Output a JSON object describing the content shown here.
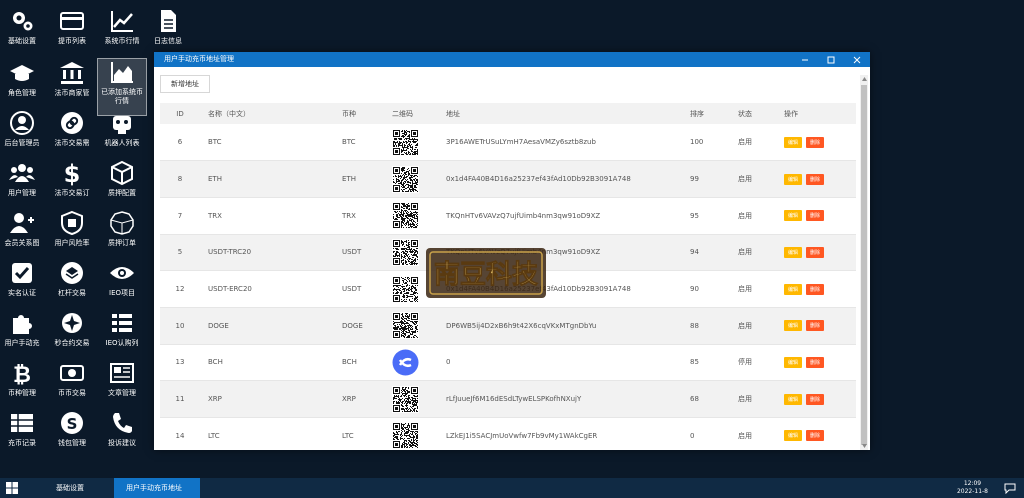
{
  "desktop_icons": [
    {
      "label": "基础设置",
      "icon": "gears-icon"
    },
    {
      "label": "提币列表",
      "icon": "card-icon"
    },
    {
      "label": "系统币行情",
      "icon": "line-chart-icon"
    },
    {
      "label": "日志信息",
      "icon": "document-icon"
    },
    {
      "label": "角色管理",
      "icon": "graduation-cap-icon"
    },
    {
      "label": "法币商家管",
      "icon": "bank-icon"
    },
    {
      "label": "已添加系统币行情",
      "icon": "area-chart-icon"
    },
    {
      "label": "后台管理员",
      "icon": "user-circle-icon"
    },
    {
      "label": "法币交易需",
      "icon": "link-circle-icon"
    },
    {
      "label": "机器人列表",
      "icon": "robot-icon"
    },
    {
      "label": "用户管理",
      "icon": "users-icon"
    },
    {
      "label": "法币交易订",
      "icon": "dollar-icon"
    },
    {
      "label": "质押配置",
      "icon": "cube-icon"
    },
    {
      "label": "会员关系图",
      "icon": "user-plus-icon"
    },
    {
      "label": "用户风险率",
      "icon": "shield-icon"
    },
    {
      "label": "质押订单",
      "icon": "dodecagon-icon"
    },
    {
      "label": "实名认证",
      "icon": "checkbox-icon"
    },
    {
      "label": "杠杆交易",
      "icon": "layers-circle-icon"
    },
    {
      "label": "IEO项目",
      "icon": "eye-icon"
    },
    {
      "label": "用户手动充",
      "icon": "puzzle-icon"
    },
    {
      "label": "秒合约交易",
      "icon": "rebel-icon"
    },
    {
      "label": "IEO认购列",
      "icon": "list-grid-icon"
    },
    {
      "label": "币种管理",
      "icon": "bitcoin-icon"
    },
    {
      "label": "币币交易",
      "icon": "money-icon"
    },
    {
      "label": "文章管理",
      "icon": "newspaper-icon"
    },
    {
      "label": "充币记录",
      "icon": "table-icon"
    },
    {
      "label": "钱包管理",
      "icon": "skype-icon"
    },
    {
      "label": "投诉建议",
      "icon": "phone-icon"
    }
  ],
  "window": {
    "title": "用户手动充币地址管理",
    "add_button": "新增地址"
  },
  "table": {
    "headers": {
      "id": "ID",
      "name": "名称（中文）",
      "coin": "币种",
      "qr": "二维码",
      "address": "地址",
      "sort": "排序",
      "status": "状态",
      "ops": "操作"
    },
    "edit_label": "编辑",
    "delete_label": "删除",
    "rows": [
      {
        "id": "6",
        "name": "BTC",
        "coin": "BTC",
        "address": "3P16AWETrUSuLYmH7AesaVMZy6sztb8zub",
        "sort": "100",
        "status": "启用",
        "qr": "qr"
      },
      {
        "id": "8",
        "name": "ETH",
        "coin": "ETH",
        "address": "0x1d4FA40B4D16a25237ef43fAd10Db92B3091A748",
        "sort": "99",
        "status": "启用",
        "qr": "qr"
      },
      {
        "id": "7",
        "name": "TRX",
        "coin": "TRX",
        "address": "TKQnHTv6VAVzQ7ujfUimb4nm3qw91oD9XZ",
        "sort": "95",
        "status": "启用",
        "qr": "qr"
      },
      {
        "id": "5",
        "name": "USDT-TRC20",
        "coin": "USDT",
        "address": "TKQnHTv6VAVzQ7ujfUimb4nm3qw91oD9XZ",
        "sort": "94",
        "status": "启用",
        "qr": "qr"
      },
      {
        "id": "12",
        "name": "USDT-ERC20",
        "coin": "USDT",
        "address": "0x1d4FA40B4D16a25237ef43fAd10Db92B3091A748",
        "sort": "90",
        "status": "启用",
        "qr": "qr"
      },
      {
        "id": "10",
        "name": "DOGE",
        "coin": "DOGE",
        "address": "DP6WB5ij4D2xB6h9t42X6cqVKxMTgnDbYu",
        "sort": "88",
        "status": "启用",
        "qr": "qr"
      },
      {
        "id": "13",
        "name": "BCH",
        "coin": "BCH",
        "address": "0",
        "sort": "85",
        "status": "停用",
        "qr": "logo"
      },
      {
        "id": "11",
        "name": "XRP",
        "coin": "XRP",
        "address": "rLfJuueJf6M16dESdLTywELSPKofhNXujY",
        "sort": "68",
        "status": "启用",
        "qr": "qr"
      },
      {
        "id": "14",
        "name": "LTC",
        "coin": "LTC",
        "address": "LZkEJ1i5SACJmUoVwfw7Fb9vMy1WAkCgER",
        "sort": "0",
        "status": "启用",
        "qr": "qr"
      }
    ]
  },
  "watermark": {
    "text": "南豆科技"
  },
  "taskbar": {
    "tasks": [
      "基础设置",
      "用户手动充币地址管理"
    ],
    "time": "12:09",
    "date": "2022-11-8"
  },
  "colors": {
    "titlebar": "#1173c6",
    "edit": "#ffb800",
    "delete": "#ff5722",
    "desktop": "#0b1929"
  }
}
